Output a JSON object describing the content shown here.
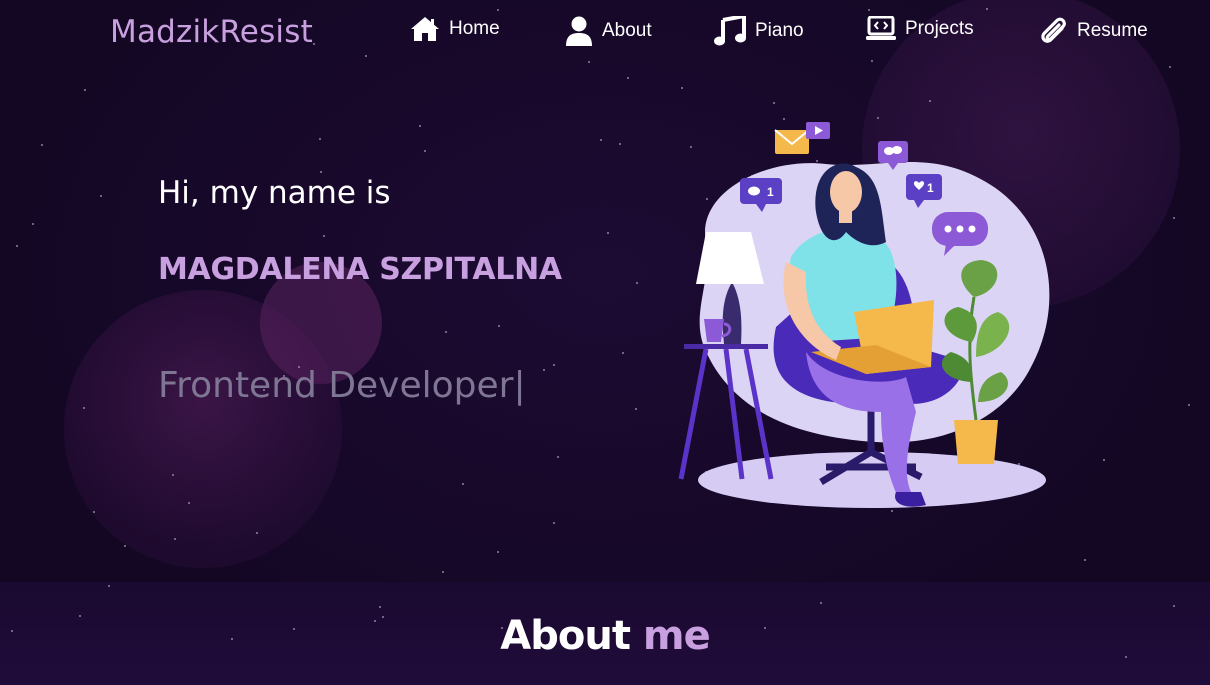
{
  "logo": "MadzikResist",
  "nav": {
    "home": "Home",
    "about": "About",
    "piano": "Piano",
    "projects": "Projects",
    "resume": "Resume"
  },
  "hero": {
    "greeting": "Hi, my name is",
    "name": "MAGDALENA SZPITALNA",
    "role": "Frontend Developer",
    "cursor": "|",
    "illustration_badges": [
      "1",
      "1"
    ]
  },
  "about_section": {
    "title_part1": "About",
    "title_part2": "me"
  },
  "colors": {
    "background": "#150826",
    "accent": "#c9a0df",
    "text": "#ffffff",
    "muted": "#7f7693"
  },
  "icons": [
    "home-icon",
    "user-icon",
    "music-icon",
    "laptop-code-icon",
    "paperclip-icon"
  ]
}
